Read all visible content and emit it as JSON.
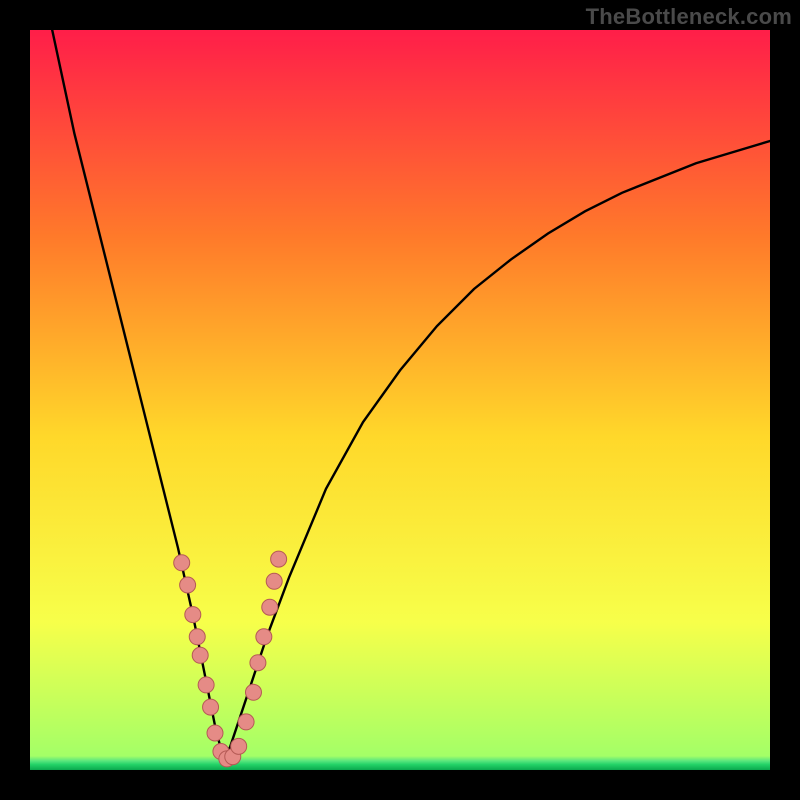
{
  "watermark": "TheBottleneck.com",
  "colors": {
    "gradient_top": "#ff1e49",
    "gradient_mid_upper": "#ff7a2a",
    "gradient_mid": "#ffd82a",
    "gradient_lower": "#f7ff4a",
    "gradient_bottom": "#9bff6a",
    "green_band": "#24d368",
    "curve": "#000000",
    "dot_fill": "#e58b86",
    "dot_stroke": "#b55a55",
    "background": "#000000"
  },
  "chart_data": {
    "type": "line",
    "title": "",
    "xlabel": "",
    "ylabel": "",
    "xlim": [
      0,
      100
    ],
    "ylim": [
      0,
      100
    ],
    "grid": false,
    "curve": {
      "comment": "V-shaped bottleneck curve; minimum at x≈26",
      "x": [
        3,
        6,
        9,
        12,
        15,
        18,
        20,
        22,
        23,
        24,
        25,
        26,
        27,
        28,
        30,
        32,
        35,
        40,
        45,
        50,
        55,
        60,
        65,
        70,
        75,
        80,
        85,
        90,
        95,
        100
      ],
      "y": [
        100,
        86,
        74,
        62,
        50,
        38,
        30,
        21,
        16,
        11,
        6,
        2,
        3,
        6,
        12,
        18,
        26,
        38,
        47,
        54,
        60,
        65,
        69,
        72.5,
        75.5,
        78,
        80,
        82,
        83.5,
        85
      ]
    },
    "dots": {
      "comment": "Highlighted sample points clustered near the trough",
      "x": [
        20.5,
        21.3,
        22.0,
        22.6,
        23.0,
        23.8,
        24.4,
        25.0,
        25.8,
        26.6,
        27.4,
        28.2,
        29.2,
        30.2,
        30.8,
        31.6,
        32.4,
        33.0,
        33.6
      ],
      "y": [
        28,
        25,
        21,
        18,
        15.5,
        11.5,
        8.5,
        5,
        2.5,
        1.5,
        1.8,
        3.2,
        6.5,
        10.5,
        14.5,
        18,
        22,
        25.5,
        28.5
      ]
    }
  }
}
